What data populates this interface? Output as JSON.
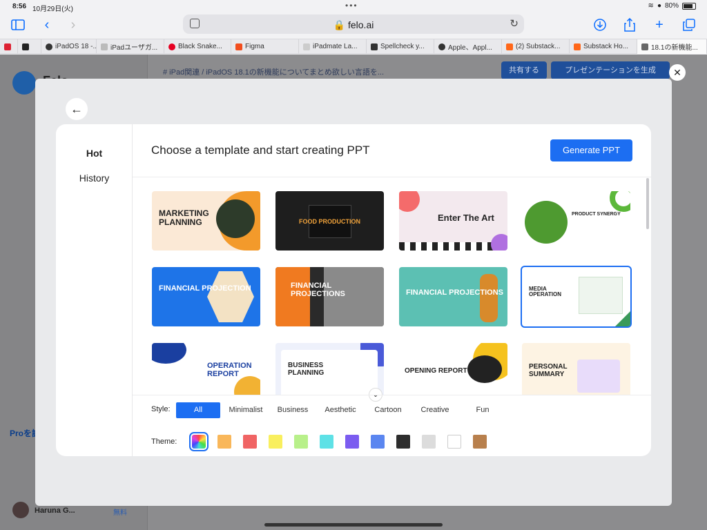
{
  "status": {
    "time": "8:56",
    "date": "10月29日(火)",
    "battery": "80%"
  },
  "browser": {
    "url": "felo.ai"
  },
  "tabs": [
    {
      "label": "",
      "color": "#d23"
    },
    {
      "label": "",
      "color": "#222"
    },
    {
      "label": "iPadOS 18 -...",
      "color": "#333"
    },
    {
      "label": "iPadユーザガ...",
      "color": "#bbb"
    },
    {
      "label": "Black Snake...",
      "color": "#e60023"
    },
    {
      "label": "Figma",
      "color": "#f24e1e"
    },
    {
      "label": "iPadmate La...",
      "color": "#ccc"
    },
    {
      "label": "Spellcheck y...",
      "color": "#333"
    },
    {
      "label": "Apple、Appl...",
      "color": "#333"
    },
    {
      "label": "(2) Substack...",
      "color": "#ff6719"
    },
    {
      "label": "Substack Ho...",
      "color": "#ff6719"
    },
    {
      "label": "18.1の新機能...",
      "color": "#666"
    }
  ],
  "background": {
    "logo_text": "Felo",
    "breadcrumb": "# iPad関連  /  iPadOS 18.1の新機能についてまとめ欲しい言語を...",
    "share_label": "共有する",
    "present_label": "プレゼンテーションを生成",
    "pro_text": "Proを試",
    "user_name": "Haruna G...",
    "free_label": "無料"
  },
  "modal": {
    "nav": {
      "hot": "Hot",
      "history": "History"
    },
    "title": "Choose a template and start creating PPT",
    "generate_label": "Generate PPT",
    "style_label": "Style:",
    "theme_label": "Theme:",
    "styles": [
      "All",
      "Minimalist",
      "Business",
      "Aesthetic",
      "Cartoon",
      "Creative",
      "Fun"
    ],
    "active_style": "All",
    "themes": [
      "#ffffff",
      "#f9b75a",
      "#f06464",
      "#f9ef5e",
      "#b8f08a",
      "#5ee1e6",
      "#7b5cf0",
      "#5b86f0",
      "#2d2d2d",
      "#dcdcdc",
      "#ffffff",
      "#b8804d"
    ]
  },
  "templates": [
    {
      "title": "MARKETING PLANNING",
      "bg": "#fbe9d6",
      "fg": "#222",
      "accent": "#f39a2b"
    },
    {
      "title": "FOOD PRODUCTION",
      "bg": "#1e1e1e",
      "fg": "#f0a23a",
      "accent": "#c0392b"
    },
    {
      "title": "Enter The Art",
      "bg": "#f3e9ee",
      "fg": "#222",
      "accent": "#b070e0"
    },
    {
      "title": "PRODUCT SYNERGY",
      "bg": "#ffffff",
      "fg": "#222",
      "accent": "#5cb83a"
    },
    {
      "title": "FINANCIAL PROJECTION",
      "bg": "#1e74e8",
      "fg": "#ffffff",
      "accent": "#1453b8"
    },
    {
      "title": "FINANCIAL PROJECTIONS",
      "bg": "#2a2a2a",
      "fg": "#ffffff",
      "accent": "#f07a20"
    },
    {
      "title": "FINANCIAL PROJECTIONS",
      "bg": "#5cc0b3",
      "fg": "#ffffff",
      "accent": "#d88a2b"
    },
    {
      "title": "MEDIA OPERATION",
      "bg": "#ffffff",
      "fg": "#222",
      "accent": "#3a9a5a"
    },
    {
      "title": "OPERATION REPORT",
      "bg": "#ffffff",
      "fg": "#1a3fa0",
      "accent": "#f2b233"
    },
    {
      "title": "BUSINESS PLANNING",
      "bg": "#eef1fb",
      "fg": "#222",
      "accent": "#4a5ad8"
    },
    {
      "title": "OPENING REPORT",
      "bg": "#ffffff",
      "fg": "#222",
      "accent": "#f5c21e"
    },
    {
      "title": "PERSONAL SUMMARY",
      "bg": "#fdf3e3",
      "fg": "#222",
      "accent": "#9a5ad8"
    }
  ]
}
